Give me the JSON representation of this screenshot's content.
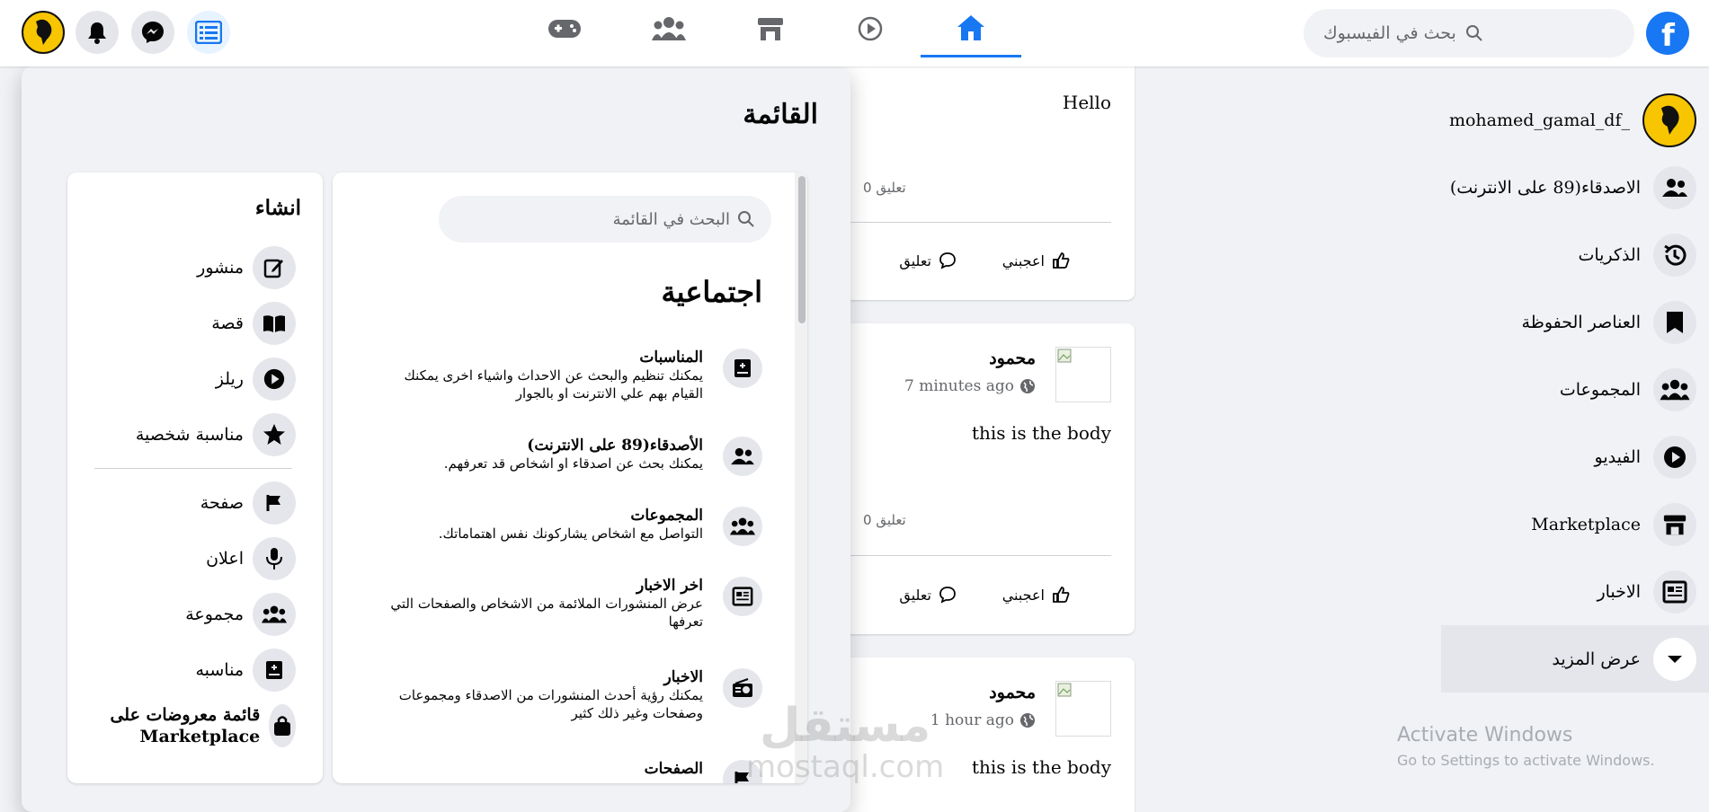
{
  "topbar": {
    "search_placeholder": "بحث في الفيسبوك",
    "nav_tabs": [
      "home-icon",
      "watch-icon",
      "marketplace-icon",
      "groups-icon",
      "gaming-icon"
    ],
    "accent": "#1877f2"
  },
  "sidebar": {
    "username": "mohamed_gamal_df_",
    "items": [
      {
        "label": "الاصدقاء(89 على الانترنت)",
        "icon": "friends-icon"
      },
      {
        "label": "الذكريات",
        "icon": "memories-icon"
      },
      {
        "label": "العناصر الحفوظة",
        "icon": "saved-icon"
      },
      {
        "label": "المجموعات",
        "icon": "groups-icon"
      },
      {
        "label": "الفيديو",
        "icon": "video-icon"
      },
      {
        "label": "Marketplace",
        "icon": "marketplace-icon"
      },
      {
        "label": "الاخبار",
        "icon": "news-icon"
      }
    ],
    "see_more": "عرض المزيد"
  },
  "feed": {
    "posts": [
      {
        "body": "Hello",
        "comments_count": "0 تعليق",
        "like_label": "اعجبني",
        "comment_label": "تعليق"
      },
      {
        "author": "محمود",
        "time": "7 minutes ago",
        "body": "this is the body",
        "comments_count": "0 تعليق",
        "like_label": "اعجبني",
        "comment_label": "تعليق"
      },
      {
        "author": "محمود",
        "time": "1 hour ago",
        "body": "this is the body"
      }
    ]
  },
  "menu": {
    "title": "القائمة",
    "search_placeholder": "البحث في القائمة",
    "social_title": "اجتماعية",
    "social_items": [
      {
        "title": "المناسبات",
        "desc": "يمكنك تنظيم والبحث عن الاحداث واشياء اخرى يمكنك القيام بهم علي الانترنت او بالجوار",
        "icon": "event-icon"
      },
      {
        "title": "الأصدقاء(89 على الانترنت)",
        "desc": "يمكنك بحث عن اصدقاء او اشخاص قد تعرفهم.",
        "icon": "friends-icon"
      },
      {
        "title": "المجموعات",
        "desc": "التواصل مع اشخاص يشاركونك نفس اهتماماتك.",
        "icon": "groups-icon"
      },
      {
        "title": "اخر الاخبار",
        "desc": "عرض المنشورات الملائمة من الاشخاص والصفحات التي تعرفها",
        "icon": "newsfeed-icon"
      },
      {
        "title": "الاخبار",
        "desc": "يمكنك رؤية أحدث المنشورات من الاصدقاء ومجموعات وصفحات وغير ذلك كثير",
        "icon": "radio-icon"
      },
      {
        "title": "الصفحات",
        "desc": "",
        "icon": "pages-icon"
      }
    ],
    "create_title": "انشاء",
    "create_items": [
      {
        "label": "منشور",
        "icon": "edit-icon"
      },
      {
        "label": "قصة",
        "icon": "book-icon"
      },
      {
        "label": "ريلز",
        "icon": "play-icon"
      },
      {
        "label": "مناسبة شخصية",
        "icon": "star-icon"
      },
      {
        "label": "صفحة",
        "icon": "flag-icon"
      },
      {
        "label": "اعلان",
        "icon": "mic-icon"
      },
      {
        "label": "مجموعة",
        "icon": "groups-icon"
      },
      {
        "label": "مناسبه",
        "icon": "event-icon"
      },
      {
        "label": "قائمة معروضات على Marketplace",
        "icon": "bag-icon"
      }
    ]
  },
  "os_overlay": {
    "activate_title": "Activate Windows",
    "activate_sub": "Go to Settings to activate Windows."
  },
  "watermark": {
    "arabic": "مستقل",
    "latin": "mostaql.com"
  }
}
